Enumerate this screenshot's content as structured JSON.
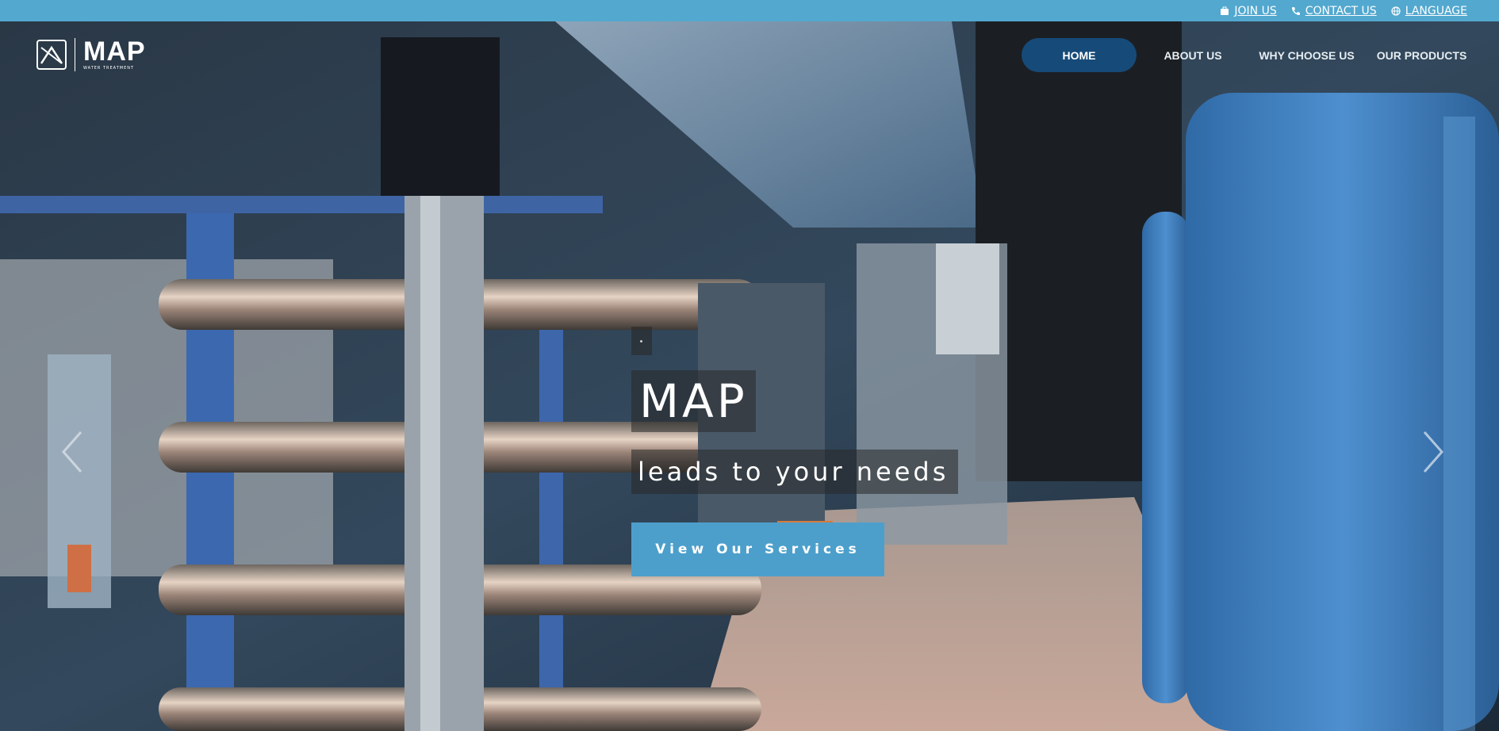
{
  "topbar": {
    "links": [
      {
        "label": "JOIN US",
        "icon": "briefcase-icon"
      },
      {
        "label": "CONTACT US",
        "icon": "phone-icon"
      },
      {
        "label": "LANGUAGE",
        "icon": "globe-icon"
      }
    ]
  },
  "logo": {
    "title": "MAP",
    "subtitle": "WATER TREATMENT"
  },
  "nav": {
    "items": [
      {
        "label": "HOME",
        "active": true
      },
      {
        "label": "ABOUT US"
      },
      {
        "label": "WHY CHOOSE US"
      },
      {
        "label": "OUR PRODUCTS"
      }
    ]
  },
  "hero": {
    "title": "MAP",
    "subtitle": "leads to your needs",
    "cta_label": "View Our Services",
    "prev_icon": "chevron-left-icon",
    "next_icon": "chevron-right-icon"
  },
  "colors": {
    "topbar": "#52a8cf",
    "nav_active": "#164a78",
    "cta": "#4d9fcb"
  }
}
